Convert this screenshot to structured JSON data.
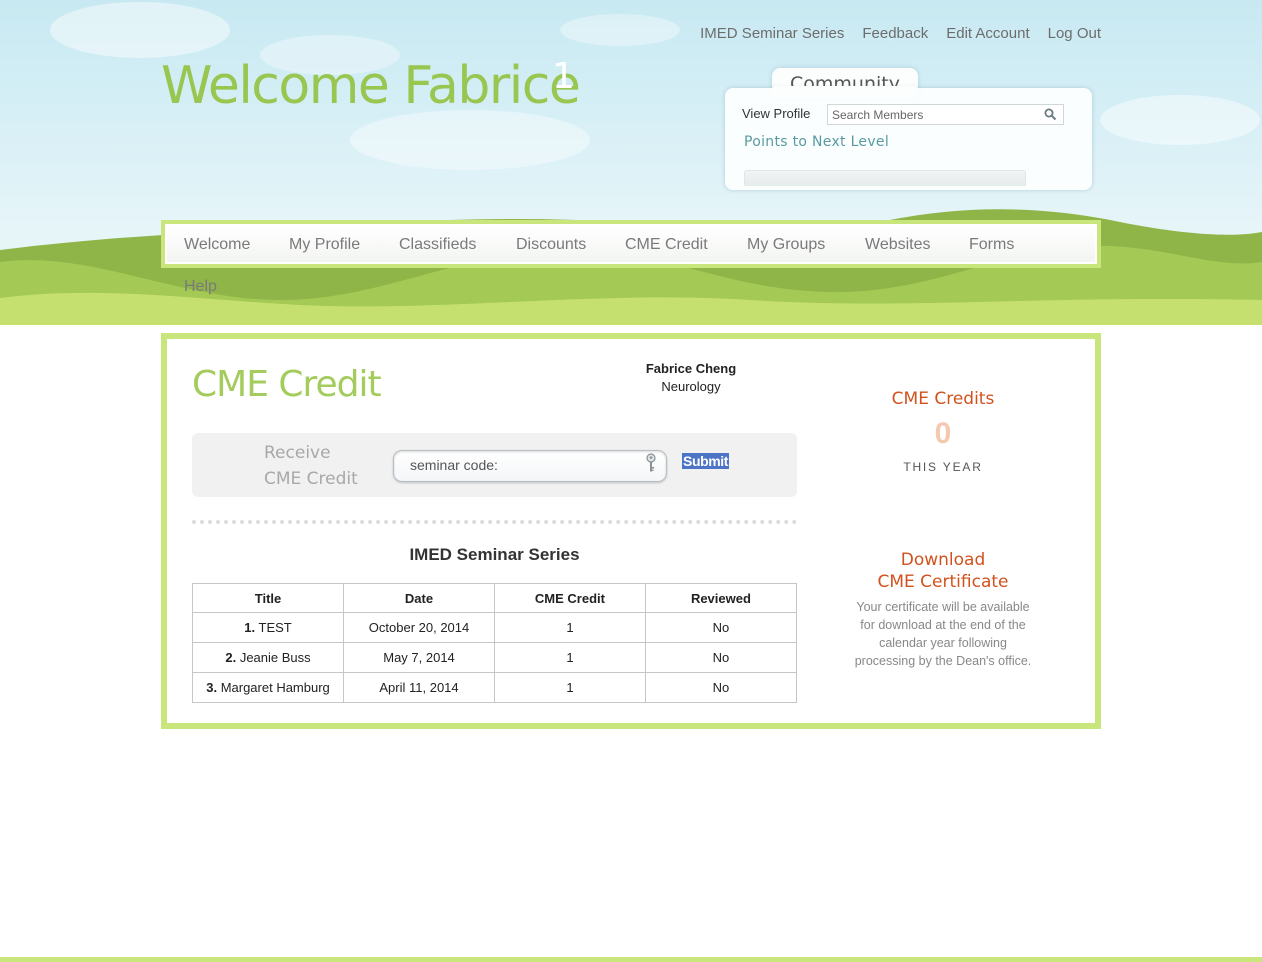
{
  "top_links": [
    "IMED Seminar Series",
    "Feedback",
    "Edit Account",
    "Log Out"
  ],
  "welcome": {
    "text": "Welcome Fabrice",
    "count": "1"
  },
  "community": {
    "tab_label": "Community",
    "view_profile": "View Profile",
    "search_placeholder": "Search Members",
    "points_label": "Points to Next Level"
  },
  "nav": {
    "items": [
      "Welcome",
      "My Profile",
      "Classifieds",
      "Discounts",
      "CME Credit",
      "My Groups",
      "Websites",
      "Forms",
      "Help"
    ]
  },
  "page": {
    "title": "CME Credit",
    "user_name": "Fabrice Cheng",
    "user_dept": "Neurology"
  },
  "receive": {
    "label_line1": "Receive",
    "label_line2": "CME Credit",
    "input_placeholder": "seminar code:",
    "submit_label": "Submit"
  },
  "series": {
    "title": "IMED Seminar Series",
    "columns": [
      "Title",
      "Date",
      "CME Credit",
      "Reviewed"
    ],
    "rows": [
      {
        "num": "1.",
        "title": "TEST",
        "date": "October 20, 2014",
        "credit": "1",
        "reviewed": "No"
      },
      {
        "num": "2.",
        "title": "Jeanie Buss",
        "date": "May 7, 2014",
        "credit": "1",
        "reviewed": "No"
      },
      {
        "num": "3.",
        "title": "Margaret Hamburg",
        "date": "April 11, 2014",
        "credit": "1",
        "reviewed": "No"
      }
    ]
  },
  "credits": {
    "title": "CME Credits",
    "value": "0",
    "period": "THIS YEAR"
  },
  "certificate": {
    "title_line1": "Download",
    "title_line2": "CME Certificate",
    "note_lines": [
      "Your certificate will be available",
      "for download at the end of the",
      "calendar year following",
      "processing by the Dean's office."
    ]
  },
  "colors": {
    "brand_green": "#a3cc5c",
    "border_green": "#c8e67c",
    "accent_orange": "#d2521e",
    "submit_blue": "#4e74c8"
  },
  "icons": {
    "search": "magnifier-icon",
    "key": "key-icon"
  }
}
